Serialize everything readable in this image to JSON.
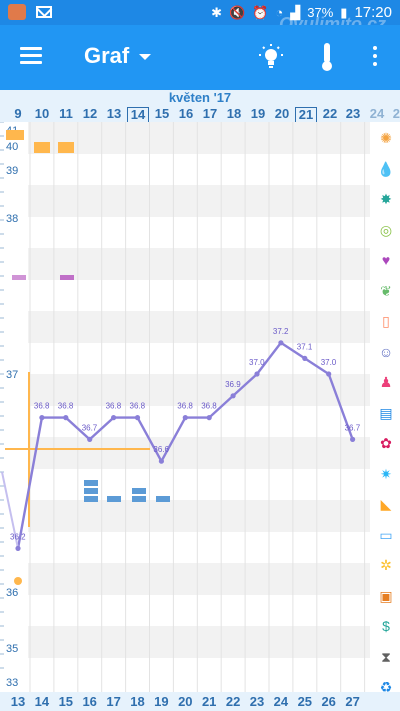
{
  "status_bar": {
    "battery": "37%",
    "time": "17:20",
    "icons": [
      "app-icon",
      "mail-icon",
      "bluetooth-icon",
      "mute-icon",
      "alarm-icon",
      "wifi-icon",
      "signal-icon",
      "battery-icon"
    ]
  },
  "watermark": "Ovulimito.cz",
  "app_bar": {
    "title": "Graf",
    "icons": [
      "menu-icon",
      "dropdown-caret-icon",
      "lightbulb-icon",
      "thermometer-icon",
      "more-vert-icon"
    ]
  },
  "month_label": "květen '17",
  "days_top": [
    "9",
    "10",
    "11",
    "12",
    "13",
    "14",
    "15",
    "16",
    "17",
    "18",
    "19",
    "20",
    "21",
    "22",
    "23",
    "24",
    "25"
  ],
  "days_bottom": [
    "13",
    "14",
    "15",
    "16",
    "17",
    "18",
    "19",
    "20",
    "21",
    "22",
    "23",
    "24",
    "25",
    "26",
    "27"
  ],
  "colors": {
    "status": "#1E88E5",
    "appbar": "#2196F3",
    "line": "#8A7FD8",
    "accent_orange": "#FFB74D",
    "bars_blue": "#5C9BD6",
    "bars_pink": "#C070C8"
  },
  "right_icons": [
    "sun-icon",
    "drop-icon",
    "bug-icon",
    "rings-icon",
    "heart-icon",
    "leaf-icon",
    "bottle-icon",
    "smile-icon",
    "figure-icon",
    "document-icon",
    "flower-icon",
    "sparkle-icon",
    "boot-icon",
    "cake-icon",
    "burst-icon",
    "monitor-icon",
    "dollar-figure-icon",
    "hourglass-icon",
    "recycle-icon"
  ],
  "chart_data": {
    "type": "line",
    "title": "",
    "xlabel": "",
    "ylabel": "",
    "y_ticks": [
      "41",
      "40",
      "39",
      "38",
      "37",
      "36",
      "35",
      "33"
    ],
    "x": [
      "13",
      "14",
      "15",
      "16",
      "17",
      "18",
      "19",
      "20",
      "21",
      "22",
      "23",
      "24",
      "25",
      "26",
      "27"
    ],
    "series": [
      {
        "values": [
          36.2,
          36.8,
          36.8,
          36.7,
          36.8,
          36.8,
          36.6,
          36.8,
          36.8,
          36.9,
          37.0,
          37.2,
          37.1,
          37.0,
          36.7
        ]
      }
    ],
    "point_labels": [
      "36.2",
      "36.8",
      "36.8",
      "36.7",
      "36.8",
      "36.8",
      "36.6",
      "36.8",
      "36.8",
      "36.9",
      "37.0",
      "37.2",
      "37.1",
      "37.0",
      "36.7"
    ],
    "ylim": [
      33,
      41
    ],
    "grid": true
  }
}
